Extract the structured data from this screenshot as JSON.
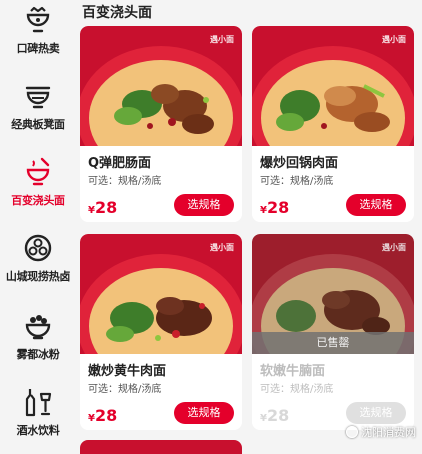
{
  "sidebar": {
    "items": [
      {
        "label": "口碑热卖",
        "icon": "bowl-crown-icon"
      },
      {
        "label": "经典板凳面",
        "icon": "bowl-bench-icon"
      },
      {
        "label": "百变浇头面",
        "icon": "bowl-steam-icon",
        "active": true
      },
      {
        "label": "山城现捞热卤",
        "icon": "braised-pot-icon"
      },
      {
        "label": "雾都冰粉",
        "icon": "ice-jelly-icon"
      },
      {
        "label": "酒水饮料",
        "icon": "bottles-icon"
      }
    ]
  },
  "section": {
    "title": "百变浇头面"
  },
  "brand_text": "遇小面",
  "products": [
    {
      "name": "Q弹肥肠面",
      "sub": "可选：规格/汤底",
      "currency": "¥",
      "price": "28",
      "button": "选规格",
      "sold_out": false
    },
    {
      "name": "爆炒回锅肉面",
      "sub": "可选：规格/汤底",
      "currency": "¥",
      "price": "28",
      "button": "选规格",
      "sold_out": false
    },
    {
      "name": "嫩炒黄牛肉面",
      "sub": "可选：规格/汤底",
      "currency": "¥",
      "price": "28",
      "button": "选规格",
      "sold_out": false
    },
    {
      "name": "软嫩牛腩面",
      "sub": "可选：规格/汤底",
      "currency": "¥",
      "price": "28",
      "button": "选规格",
      "sold_out": true,
      "sold_label": "已售罄"
    }
  ],
  "watermark": "沈阳消费网",
  "colors": {
    "accent": "#e4002b",
    "background": "#f4f4f4",
    "sold_button": "#e0e0e0"
  }
}
